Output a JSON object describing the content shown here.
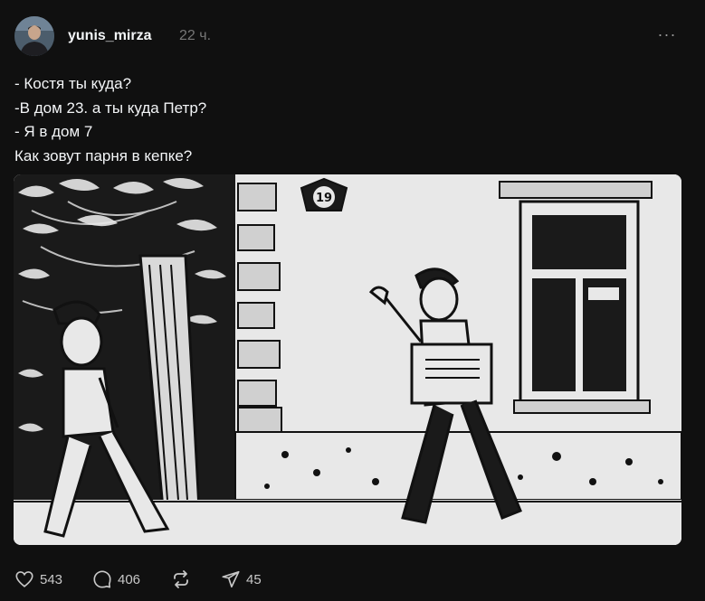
{
  "post": {
    "username": "yunis_mirza",
    "time": "22 ч.",
    "more_label": "···",
    "lines": [
      "- Костя ты куда?",
      "-В дом 23. а ты куда Петр?",
      "- Я в дом 7",
      "Как зовут парня в кепке?"
    ],
    "house_number": "19"
  },
  "actions": {
    "likes": "543",
    "comments": "406",
    "reposts": "",
    "shares": "45"
  },
  "icons": {
    "like": "heart-icon",
    "comment": "comment-icon",
    "repost": "repost-icon",
    "share": "send-icon",
    "more": "more-icon"
  },
  "colors": {
    "background": "#101010",
    "text": "#f3f5f7",
    "muted": "#777777"
  }
}
